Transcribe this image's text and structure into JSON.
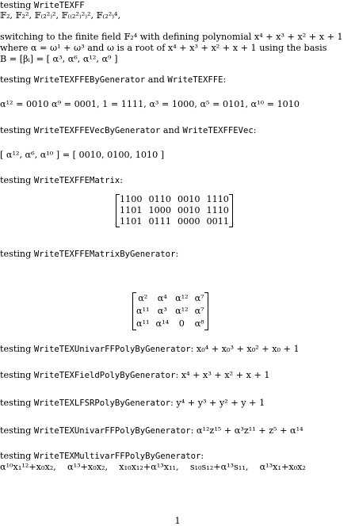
{
  "l1_pre": "testing ",
  "l1_code": "WriteTEXFF",
  "l2": "𝔽₂, 𝔽₂², 𝔽₍₂²₎², 𝔽₍₍₂²₎²₎², 𝔽₍₂²₎⁴,",
  "switch_line1": "switching to the finite field 𝔽₂⁴ with defining polynomial x⁴ + x³ + x² + x + 1",
  "switch_line2": "where α = ω¹ + ω³ and ω is a root of x⁴ + x³ + x² + x + 1 using the basis",
  "switch_line3": "B = [βᵢ] = [ α³, α⁶, α¹², α⁹ ]",
  "s1_pre": "testing ",
  "s1_code1": "WriteTEXFFEByGenerator",
  "s1_mid": " and ",
  "s1_code2": "WriteTEXFFE",
  "s1_post": ":",
  "s1_result": "α¹² = 0010 α⁹ = 0001, 1 = 1111, α³ = 1000, α⁵ = 0101, α¹⁰ = 1010",
  "s2_pre": "testing ",
  "s2_code1": "WriteTEXFFEVecByGenerator",
  "s2_mid": " and ",
  "s2_code2": "WriteTEXFFEVec",
  "s2_post": ":",
  "s2_result": "[ α¹², α⁶, α¹⁰ ] = [ 0010, 0100, 1010 ]",
  "s3_pre": "testing ",
  "s3_code": "WriteTEXFFEMatrix",
  "s3_post": ":",
  "matrix1": [
    [
      "1100",
      "0110",
      "0010",
      "1110"
    ],
    [
      "1101",
      "1000",
      "0010",
      "1110"
    ],
    [
      "1101",
      "0111",
      "0000",
      "0011"
    ]
  ],
  "s4_pre": "testing ",
  "s4_code": "WriteTEXFFEMatrixByGenerator",
  "s4_post": ":",
  "matrix2": [
    [
      "α²",
      "α⁴",
      "α¹²",
      "α⁷"
    ],
    [
      "α¹¹",
      "α³",
      "α¹²",
      "α⁷"
    ],
    [
      "α¹¹",
      "α¹⁴",
      "0",
      "α⁸"
    ]
  ],
  "s5_pre": "testing ",
  "s5_code": "WriteTEXUnivarFFPolyByGenerator",
  "s5_post": ": x₀⁴ + x₀³ + x₀² + x₀ + 1",
  "s6_pre": "testing ",
  "s6_code": "WriteTEXFieldPolyByGenerator",
  "s6_post": ": x⁴ + x³ + x² + x + 1",
  "s7_pre": "testing ",
  "s7_code": "WriteTEXLFSRPolyByGenerator",
  "s7_post": ": y⁴ + y³ + y² + y + 1",
  "s8_pre": "testing ",
  "s8_code": "WriteTEXUnivarFFPolyByGenerator",
  "s8_post": ": α¹²z¹⁵ + α³z¹¹ + z⁵ + α¹⁴",
  "s9_pre": "testing ",
  "s9_code": "WriteTEXMultivarFFPolyByGenerator",
  "s9_post": ":",
  "s9_result": "α¹⁰x₁¹²+x₀x₂,    α¹³+x₀x₂,    x₁₀x₁₂+α¹³x₁₁,    s₁₀s₁₂+α¹³s₁₁,    α¹³x₁+x₀x₂",
  "page_number": "1"
}
